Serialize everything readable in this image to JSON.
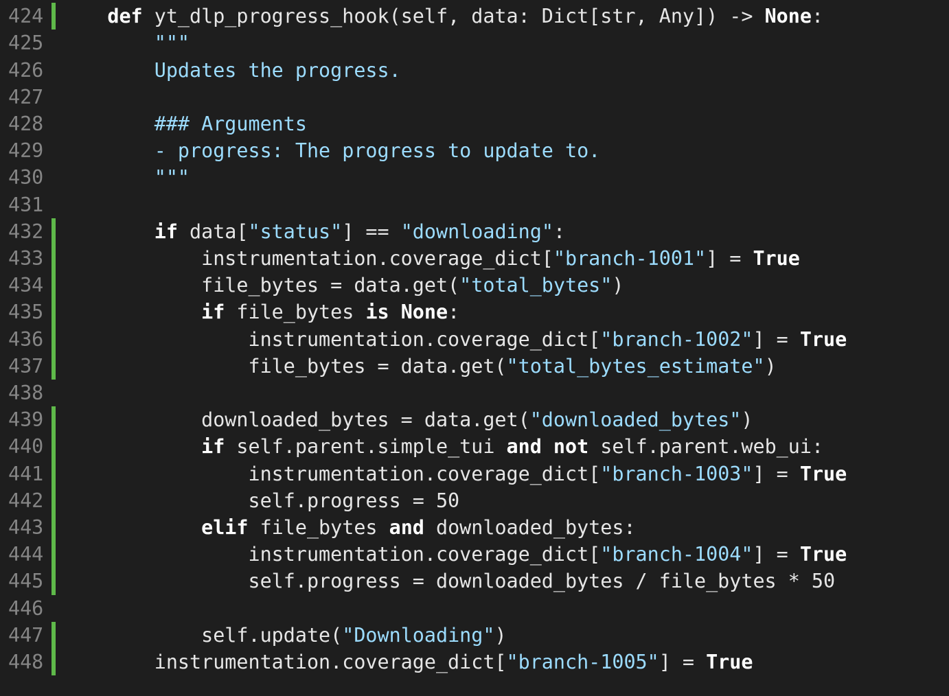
{
  "editor": {
    "colors": {
      "background": "#1e1e1e",
      "line_number": "#858585",
      "diff_marker": "#5fb94a",
      "keyword": "#ffffff",
      "string": "#9cdcfe",
      "text": "#e6e6e6"
    },
    "lines": [
      {
        "num": "424",
        "changed": true,
        "tokens": [
          {
            "t": "    ",
            "k": "plain"
          },
          {
            "t": "def",
            "k": "kw"
          },
          {
            "t": " yt_dlp_progress_hook(self, data: Dict[str, Any]) -> ",
            "k": "plain"
          },
          {
            "t": "None",
            "k": "kw"
          },
          {
            "t": ":",
            "k": "plain"
          }
        ]
      },
      {
        "num": "425",
        "changed": false,
        "tokens": [
          {
            "t": "        ",
            "k": "plain"
          },
          {
            "t": "\"\"\"",
            "k": "doc"
          }
        ]
      },
      {
        "num": "426",
        "changed": false,
        "tokens": [
          {
            "t": "        ",
            "k": "plain"
          },
          {
            "t": "Updates the progress.",
            "k": "doc"
          }
        ]
      },
      {
        "num": "427",
        "changed": false,
        "tokens": []
      },
      {
        "num": "428",
        "changed": false,
        "tokens": [
          {
            "t": "        ",
            "k": "plain"
          },
          {
            "t": "### Arguments",
            "k": "doc"
          }
        ]
      },
      {
        "num": "429",
        "changed": false,
        "tokens": [
          {
            "t": "        ",
            "k": "plain"
          },
          {
            "t": "- progress: The progress to update to.",
            "k": "doc"
          }
        ]
      },
      {
        "num": "430",
        "changed": false,
        "tokens": [
          {
            "t": "        ",
            "k": "plain"
          },
          {
            "t": "\"\"\"",
            "k": "doc"
          }
        ]
      },
      {
        "num": "431",
        "changed": false,
        "tokens": []
      },
      {
        "num": "432",
        "changed": true,
        "tokens": [
          {
            "t": "        ",
            "k": "plain"
          },
          {
            "t": "if",
            "k": "kw"
          },
          {
            "t": " data[",
            "k": "plain"
          },
          {
            "t": "\"status\"",
            "k": "str"
          },
          {
            "t": "] == ",
            "k": "plain"
          },
          {
            "t": "\"downloading\"",
            "k": "str"
          },
          {
            "t": ":",
            "k": "plain"
          }
        ]
      },
      {
        "num": "433",
        "changed": true,
        "tokens": [
          {
            "t": "            instrumentation.coverage_dict[",
            "k": "plain"
          },
          {
            "t": "\"branch-1001\"",
            "k": "str"
          },
          {
            "t": "] = ",
            "k": "plain"
          },
          {
            "t": "True",
            "k": "kw"
          }
        ]
      },
      {
        "num": "434",
        "changed": true,
        "tokens": [
          {
            "t": "            file_bytes = data.get(",
            "k": "plain"
          },
          {
            "t": "\"total_bytes\"",
            "k": "str"
          },
          {
            "t": ")",
            "k": "plain"
          }
        ]
      },
      {
        "num": "435",
        "changed": true,
        "tokens": [
          {
            "t": "            ",
            "k": "plain"
          },
          {
            "t": "if",
            "k": "kw"
          },
          {
            "t": " file_bytes ",
            "k": "plain"
          },
          {
            "t": "is",
            "k": "kw"
          },
          {
            "t": " ",
            "k": "plain"
          },
          {
            "t": "None",
            "k": "kw"
          },
          {
            "t": ":",
            "k": "plain"
          }
        ]
      },
      {
        "num": "436",
        "changed": true,
        "tokens": [
          {
            "t": "                instrumentation.coverage_dict[",
            "k": "plain"
          },
          {
            "t": "\"branch-1002\"",
            "k": "str"
          },
          {
            "t": "] = ",
            "k": "plain"
          },
          {
            "t": "True",
            "k": "kw"
          }
        ]
      },
      {
        "num": "437",
        "changed": true,
        "tokens": [
          {
            "t": "                file_bytes = data.get(",
            "k": "plain"
          },
          {
            "t": "\"total_bytes_estimate\"",
            "k": "str"
          },
          {
            "t": ")",
            "k": "plain"
          }
        ]
      },
      {
        "num": "438",
        "changed": false,
        "tokens": []
      },
      {
        "num": "439",
        "changed": true,
        "tokens": [
          {
            "t": "            downloaded_bytes = data.get(",
            "k": "plain"
          },
          {
            "t": "\"downloaded_bytes\"",
            "k": "str"
          },
          {
            "t": ")",
            "k": "plain"
          }
        ]
      },
      {
        "num": "440",
        "changed": true,
        "tokens": [
          {
            "t": "            ",
            "k": "plain"
          },
          {
            "t": "if",
            "k": "kw"
          },
          {
            "t": " self.parent.simple_tui ",
            "k": "plain"
          },
          {
            "t": "and",
            "k": "kw"
          },
          {
            "t": " ",
            "k": "plain"
          },
          {
            "t": "not",
            "k": "kw"
          },
          {
            "t": " self.parent.web_ui:",
            "k": "plain"
          }
        ]
      },
      {
        "num": "441",
        "changed": true,
        "tokens": [
          {
            "t": "                instrumentation.coverage_dict[",
            "k": "plain"
          },
          {
            "t": "\"branch-1003\"",
            "k": "str"
          },
          {
            "t": "] = ",
            "k": "plain"
          },
          {
            "t": "True",
            "k": "kw"
          }
        ]
      },
      {
        "num": "442",
        "changed": true,
        "tokens": [
          {
            "t": "                self.progress = 50",
            "k": "plain"
          }
        ]
      },
      {
        "num": "443",
        "changed": true,
        "tokens": [
          {
            "t": "            ",
            "k": "plain"
          },
          {
            "t": "elif",
            "k": "kw"
          },
          {
            "t": " file_bytes ",
            "k": "plain"
          },
          {
            "t": "and",
            "k": "kw"
          },
          {
            "t": " downloaded_bytes:",
            "k": "plain"
          }
        ]
      },
      {
        "num": "444",
        "changed": true,
        "tokens": [
          {
            "t": "                instrumentation.coverage_dict[",
            "k": "plain"
          },
          {
            "t": "\"branch-1004\"",
            "k": "str"
          },
          {
            "t": "] = ",
            "k": "plain"
          },
          {
            "t": "True",
            "k": "kw"
          }
        ]
      },
      {
        "num": "445",
        "changed": true,
        "tokens": [
          {
            "t": "                self.progress = downloaded_bytes / file_bytes * 50",
            "k": "plain"
          }
        ]
      },
      {
        "num": "446",
        "changed": false,
        "tokens": []
      },
      {
        "num": "447",
        "changed": true,
        "tokens": [
          {
            "t": "            self.update(",
            "k": "plain"
          },
          {
            "t": "\"Downloading\"",
            "k": "str"
          },
          {
            "t": ")",
            "k": "plain"
          }
        ]
      },
      {
        "num": "448",
        "changed": true,
        "tokens": [
          {
            "t": "        instrumentation.coverage_dict[",
            "k": "plain"
          },
          {
            "t": "\"branch-1005\"",
            "k": "str"
          },
          {
            "t": "] = ",
            "k": "plain"
          },
          {
            "t": "True",
            "k": "kw"
          }
        ]
      }
    ]
  }
}
